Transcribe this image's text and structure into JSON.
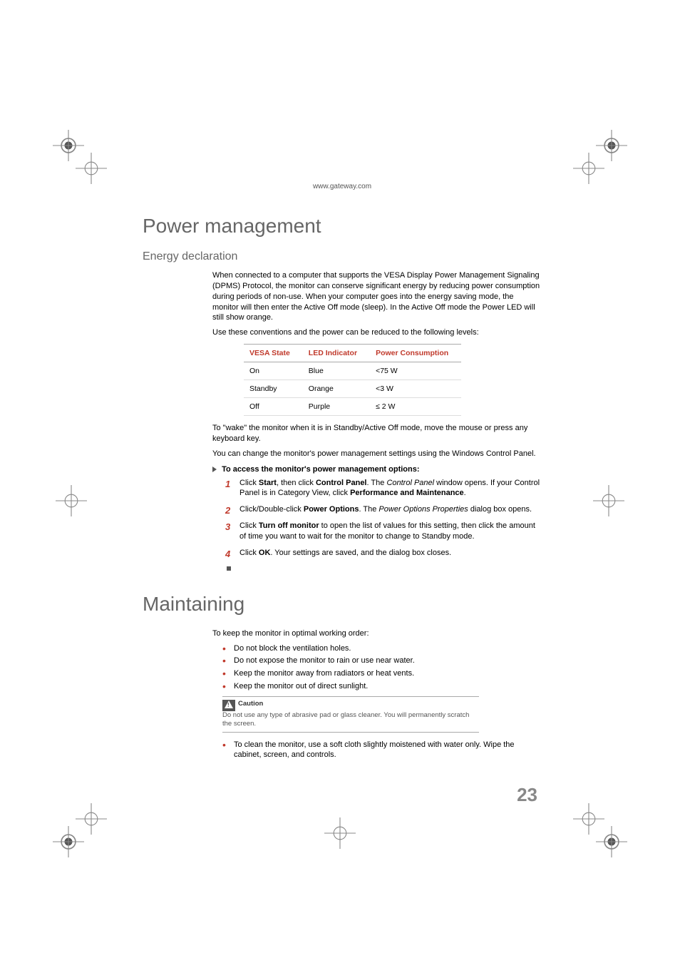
{
  "header": {
    "url": "www.gateway.com"
  },
  "section1": {
    "title": "Power management",
    "sub1": {
      "title": "Energy declaration",
      "p1": "When connected to a computer that supports the VESA Display Power Management Signaling (DPMS) Protocol, the monitor can conserve significant energy by reducing power consumption during periods of non-use. When your computer goes into the energy saving mode, the monitor will then enter the Active Off mode (sleep). In the Active Off mode the Power LED will still show orange.",
      "p2": "Use these conventions and the power can be reduced to the following levels:",
      "table": {
        "headers": [
          "VESA State",
          "LED Indicator",
          "Power Consumption"
        ],
        "rows": [
          [
            "On",
            "Blue",
            "<75 W"
          ],
          [
            "Standby",
            "Orange",
            "<3 W"
          ],
          [
            "Off",
            "Purple",
            "≤ 2 W"
          ]
        ]
      },
      "p3": "To \"wake\" the monitor when it is in Standby/Active Off mode, move the mouse or press any keyboard key.",
      "p4": "You can change the monitor's power management settings using the Windows Control Panel.",
      "proc_title": "To access the monitor's power management options:",
      "steps": {
        "s1_a": "Click ",
        "s1_b": "Start",
        "s1_c": ", then click ",
        "s1_d": "Control Panel",
        "s1_e": ". The ",
        "s1_f": "Control Panel",
        "s1_g": " window opens. If your Control Panel is in Category View, click ",
        "s1_h": "Performance and Maintenance",
        "s1_i": ".",
        "s2_a": "Click/Double-click ",
        "s2_b": "Power Options",
        "s2_c": ". The ",
        "s2_d": "Power Options Properties",
        "s2_e": " dialog box opens.",
        "s3_a": "Click ",
        "s3_b": "Turn off monitor",
        "s3_c": " to open the list of values for this setting, then click the amount of time you want to wait for the monitor to change to Standby mode.",
        "s4_a": "Click ",
        "s4_b": "OK",
        "s4_c": ". Your settings are saved, and the dialog box closes."
      }
    }
  },
  "section2": {
    "title": "Maintaining",
    "intro": "To keep the monitor in optimal working order:",
    "bullets": [
      "Do not block the ventilation holes.",
      "Do not expose the monitor to rain or use near water.",
      "Keep the monitor away from radiators or heat vents.",
      "Keep the monitor out of direct sunlight."
    ],
    "caution": {
      "title": "Caution",
      "text": "Do not use any type of abrasive pad or glass cleaner. You will permanently scratch the screen."
    },
    "bullet_after": "To clean the monitor, use a soft cloth slightly moistened with water only. Wipe the cabinet, screen, and controls."
  },
  "page_number": "23",
  "chart_data": {
    "type": "table",
    "title": "VESA Power Management Levels",
    "columns": [
      "VESA State",
      "LED Indicator",
      "Power Consumption"
    ],
    "rows": [
      {
        "state": "On",
        "led": "Blue",
        "power_w": "<75"
      },
      {
        "state": "Standby",
        "led": "Orange",
        "power_w": "<3"
      },
      {
        "state": "Off",
        "led": "Purple",
        "power_w": "≤2"
      }
    ]
  }
}
